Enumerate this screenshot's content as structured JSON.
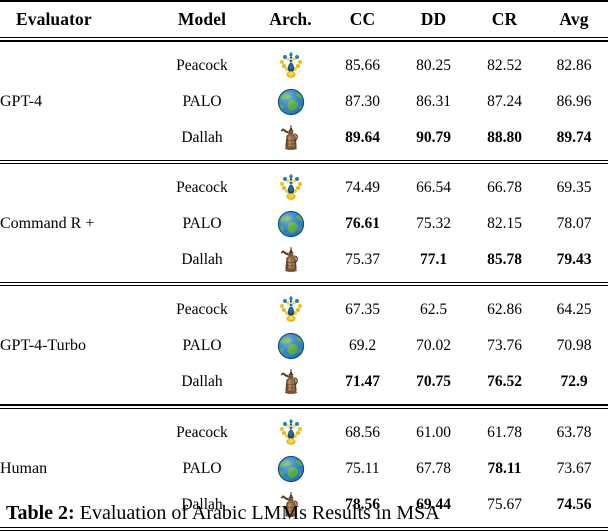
{
  "table": {
    "columns": [
      {
        "key": "evaluator",
        "label": "Evaluator",
        "align": "left"
      },
      {
        "key": "model",
        "label": "Model",
        "align": "center"
      },
      {
        "key": "arch",
        "label": "Arch.",
        "align": "center"
      },
      {
        "key": "cc",
        "label": "CC",
        "align": "center"
      },
      {
        "key": "dd",
        "label": "DD",
        "align": "center"
      },
      {
        "key": "cr",
        "label": "CR",
        "align": "center"
      },
      {
        "key": "avg",
        "label": "Avg",
        "align": "center"
      }
    ],
    "blocks": [
      {
        "evaluator": "GPT-4",
        "rows": [
          {
            "model": "Peacock",
            "arch_icon": "peacock-icon",
            "cc": "85.66",
            "cc_bold": false,
            "dd": "80.25",
            "dd_bold": false,
            "cr": "82.52",
            "cr_bold": false,
            "avg": "82.86",
            "avg_bold": false
          },
          {
            "model": "PALO",
            "arch_icon": "globe-icon",
            "cc": "87.30",
            "cc_bold": false,
            "dd": "86.31",
            "dd_bold": false,
            "cr": "87.24",
            "cr_bold": false,
            "avg": "86.96",
            "avg_bold": false
          },
          {
            "model": "Dallah",
            "arch_icon": "dallah-icon",
            "cc": "89.64",
            "cc_bold": true,
            "dd": "90.79",
            "dd_bold": true,
            "cr": "88.80",
            "cr_bold": true,
            "avg": "89.74",
            "avg_bold": true
          }
        ]
      },
      {
        "evaluator": "Command R +",
        "rows": [
          {
            "model": "Peacock",
            "arch_icon": "peacock-icon",
            "cc": "74.49",
            "cc_bold": false,
            "dd": "66.54",
            "dd_bold": false,
            "cr": "66.78",
            "cr_bold": false,
            "avg": "69.35",
            "avg_bold": false
          },
          {
            "model": "PALO",
            "arch_icon": "globe-icon",
            "cc": "76.61",
            "cc_bold": true,
            "dd": "75.32",
            "dd_bold": false,
            "cr": "82.15",
            "cr_bold": false,
            "avg": "78.07",
            "avg_bold": false
          },
          {
            "model": "Dallah",
            "arch_icon": "dallah-icon",
            "cc": "75.37",
            "cc_bold": false,
            "dd": "77.1",
            "dd_bold": true,
            "cr": "85.78",
            "cr_bold": true,
            "avg": "79.43",
            "avg_bold": true
          }
        ]
      },
      {
        "evaluator": "GPT-4-Turbo",
        "rows": [
          {
            "model": "Peacock",
            "arch_icon": "peacock-icon",
            "cc": "67.35",
            "cc_bold": false,
            "dd": "62.5",
            "dd_bold": false,
            "cr": "62.86",
            "cr_bold": false,
            "avg": "64.25",
            "avg_bold": false
          },
          {
            "model": "PALO",
            "arch_icon": "globe-icon",
            "cc": "69.2",
            "cc_bold": false,
            "dd": "70.02",
            "dd_bold": false,
            "cr": "73.76",
            "cr_bold": false,
            "avg": "70.98",
            "avg_bold": false
          },
          {
            "model": "Dallah",
            "arch_icon": "dallah-icon",
            "cc": "71.47",
            "cc_bold": true,
            "dd": "70.75",
            "dd_bold": true,
            "cr": "76.52",
            "cr_bold": true,
            "avg": "72.9",
            "avg_bold": true
          }
        ]
      },
      {
        "evaluator": "Human",
        "rows": [
          {
            "model": "Peacock",
            "arch_icon": "peacock-icon",
            "cc": "68.56",
            "cc_bold": false,
            "dd": "61.00",
            "dd_bold": false,
            "cr": "61.78",
            "cr_bold": false,
            "avg": "63.78",
            "avg_bold": false
          },
          {
            "model": "PALO",
            "arch_icon": "globe-icon",
            "cc": "75.11",
            "cc_bold": false,
            "dd": "67.78",
            "dd_bold": false,
            "cr": "78.11",
            "cr_bold": true,
            "avg": "73.67",
            "avg_bold": false
          },
          {
            "model": "Dallah",
            "arch_icon": "dallah-icon",
            "cc": "78.56",
            "cc_bold": true,
            "dd": "69.44",
            "dd_bold": true,
            "cr": "75.67",
            "cr_bold": false,
            "avg": "74.56",
            "avg_bold": true
          }
        ]
      }
    ]
  },
  "caption": {
    "label": "Table 2:",
    "text": " Evaluation of Arabic LMMs Results in MSA"
  }
}
